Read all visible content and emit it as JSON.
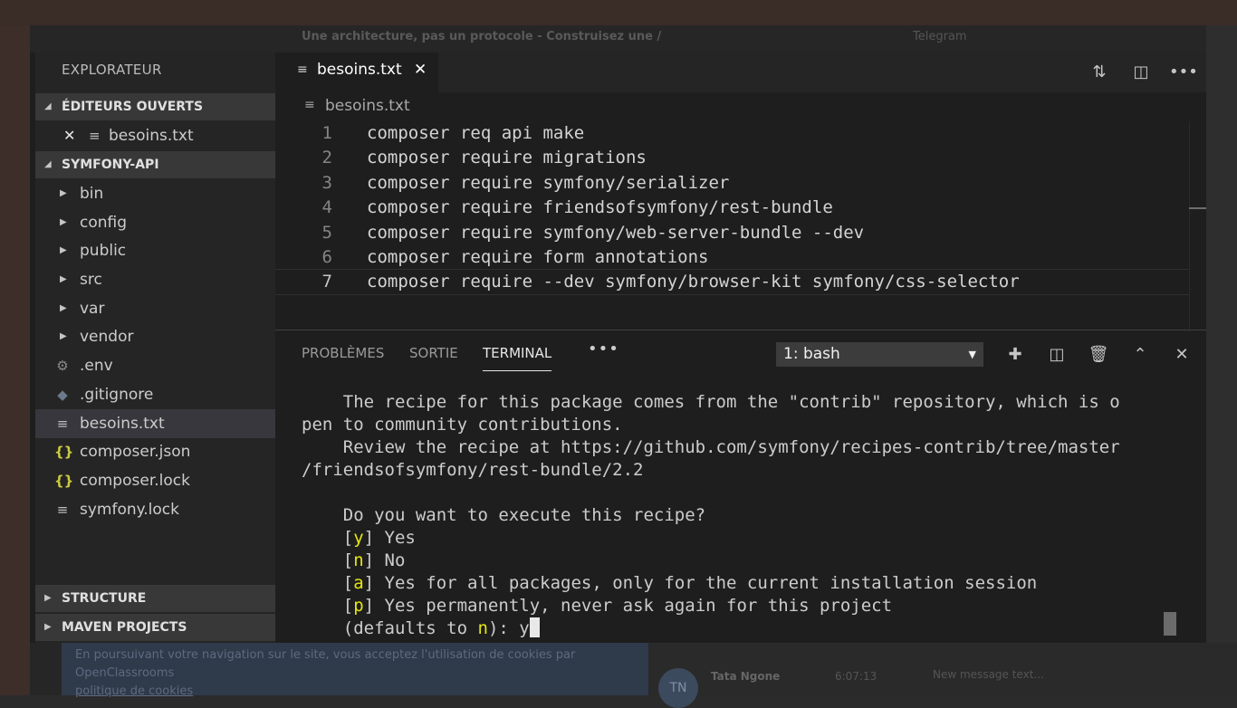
{
  "background": {
    "browser_tab_title": "Une architecture, pas un protocole - Construisez une /",
    "telegram_title": "Telegram",
    "cookie_text": "En poursuivant votre navigation sur le site, vous acceptez l'utilisation de cookies par OpenClassrooms",
    "cookie_link": "politique de cookies",
    "chat_avatar": "TN",
    "chat_name": "Tata Ngone",
    "chat_time": "6:07:13",
    "chat_placeholder": "New message text..."
  },
  "sidebar": {
    "title": "EXPLORATEUR",
    "open_editors_label": "ÉDITEURS OUVERTS",
    "open_editors": [
      {
        "name": "besoins.txt"
      }
    ],
    "project_label": "SYMFONY-API",
    "items": [
      {
        "name": "bin",
        "type": "folder"
      },
      {
        "name": "config",
        "type": "folder"
      },
      {
        "name": "public",
        "type": "folder"
      },
      {
        "name": "src",
        "type": "folder"
      },
      {
        "name": "var",
        "type": "folder"
      },
      {
        "name": "vendor",
        "type": "folder"
      },
      {
        "name": ".env",
        "type": "gear-icon"
      },
      {
        "name": ".gitignore",
        "type": "git-icon"
      },
      {
        "name": "besoins.txt",
        "type": "text-icon",
        "selected": true
      },
      {
        "name": "composer.json",
        "type": "braces-icon"
      },
      {
        "name": "composer.lock",
        "type": "braces-icon"
      },
      {
        "name": "symfony.lock",
        "type": "text-icon"
      }
    ],
    "structure_label": "STRUCTURE",
    "maven_label": "MAVEN PROJECTS"
  },
  "editor": {
    "tab_name": "besoins.txt",
    "breadcrumb": "besoins.txt",
    "lines": [
      "composer req api make",
      "composer require migrations",
      "composer require symfony/serializer",
      "composer require friendsofsymfony/rest-bundle",
      "composer require symfony/web-server-bundle --dev",
      "composer require form annotations",
      "composer require --dev symfony/browser-kit symfony/css-selector"
    ],
    "line_numbers": [
      "1",
      "2",
      "3",
      "4",
      "5",
      "6",
      "7"
    ],
    "current_line": 7
  },
  "panel": {
    "tabs": [
      "PROBLÈMES",
      "SORTIE",
      "TERMINAL"
    ],
    "active_tab": "TERMINAL",
    "more": "•••",
    "terminal_select": "1: bash",
    "terminal_lines": [
      "    The recipe for this package comes from the \"contrib\" repository, which is o",
      "pen to community contributions.",
      "    Review the recipe at https://github.com/symfony/recipes-contrib/tree/master",
      "/friendsofsymfony/rest-bundle/2.2",
      "",
      "    Do you want to execute this recipe?"
    ],
    "options": [
      {
        "key": "y",
        "text": "Yes"
      },
      {
        "key": "n",
        "text": "No"
      },
      {
        "key": "a",
        "text": "Yes for all packages, only for the current installation session"
      },
      {
        "key": "p",
        "text": "Yes permanently, never ask again for this project"
      }
    ],
    "prompt_before": "(defaults to ",
    "prompt_key": "n",
    "prompt_after": "): ",
    "prompt_input": "y"
  },
  "colors": {
    "accent_yellow": "#e5e510",
    "editor_bg": "#1e1e1e",
    "sidebar_bg": "#252526"
  }
}
